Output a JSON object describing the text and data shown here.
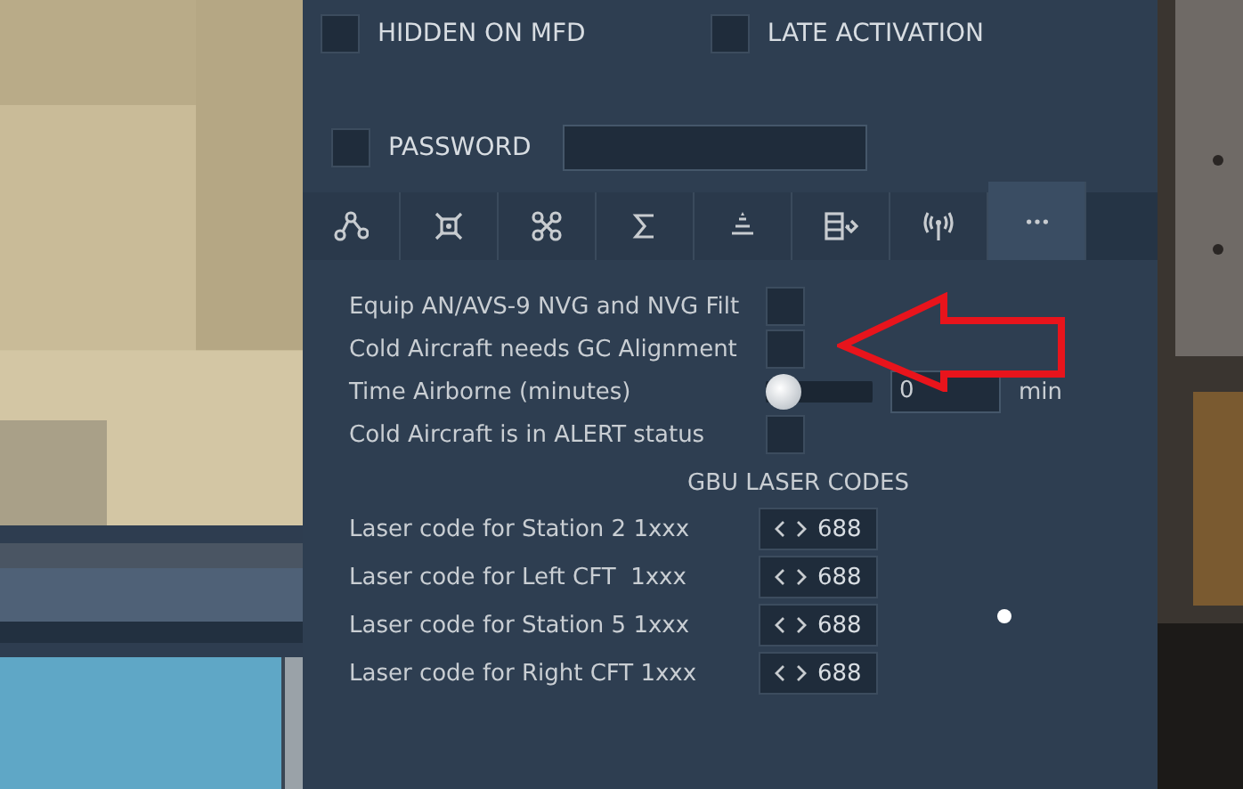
{
  "options_panel": {
    "flags": [
      {
        "label": "HIDDEN ON MFD",
        "checked": false
      },
      {
        "label": "LATE ACTIVATION",
        "checked": false
      }
    ],
    "password": {
      "label": "PASSWORD",
      "checked": false
    },
    "tabs": [
      {
        "kind": "route",
        "selected": false
      },
      {
        "kind": "target",
        "selected": false
      },
      {
        "kind": "drone",
        "selected": false
      },
      {
        "kind": "sigma",
        "selected": false
      },
      {
        "kind": "pyramid",
        "selected": false
      },
      {
        "kind": "list",
        "selected": false
      },
      {
        "kind": "antenna",
        "selected": false
      },
      {
        "kind": "more",
        "selected": true
      }
    ],
    "settings": [
      {
        "kind": "checkbox",
        "label": "Equip AN/AVS-9 NVG and NVG Filt",
        "checked": false
      },
      {
        "kind": "checkbox",
        "label": "Cold Aircraft needs GC Alignment",
        "checked": false
      },
      {
        "kind": "slider",
        "label": "Time Airborne (minutes)",
        "level": 0,
        "value": "0",
        "unit": "min"
      },
      {
        "kind": "checkbox",
        "label": "Cold Aircraft is in ALERT status",
        "checked": false
      }
    ],
    "laser_codes": {
      "title": "GBU LASER CODES",
      "rows": [
        {
          "label": "Laser code for Station 2 1xxx",
          "value": "688"
        },
        {
          "label": "Laser code for Left CFT  1xxx",
          "value": "688"
        },
        {
          "label": "Laser code for Station 5 1xxx",
          "value": "688"
        },
        {
          "label": "Laser code for Right CFT 1xxx",
          "value": "688"
        }
      ]
    }
  }
}
